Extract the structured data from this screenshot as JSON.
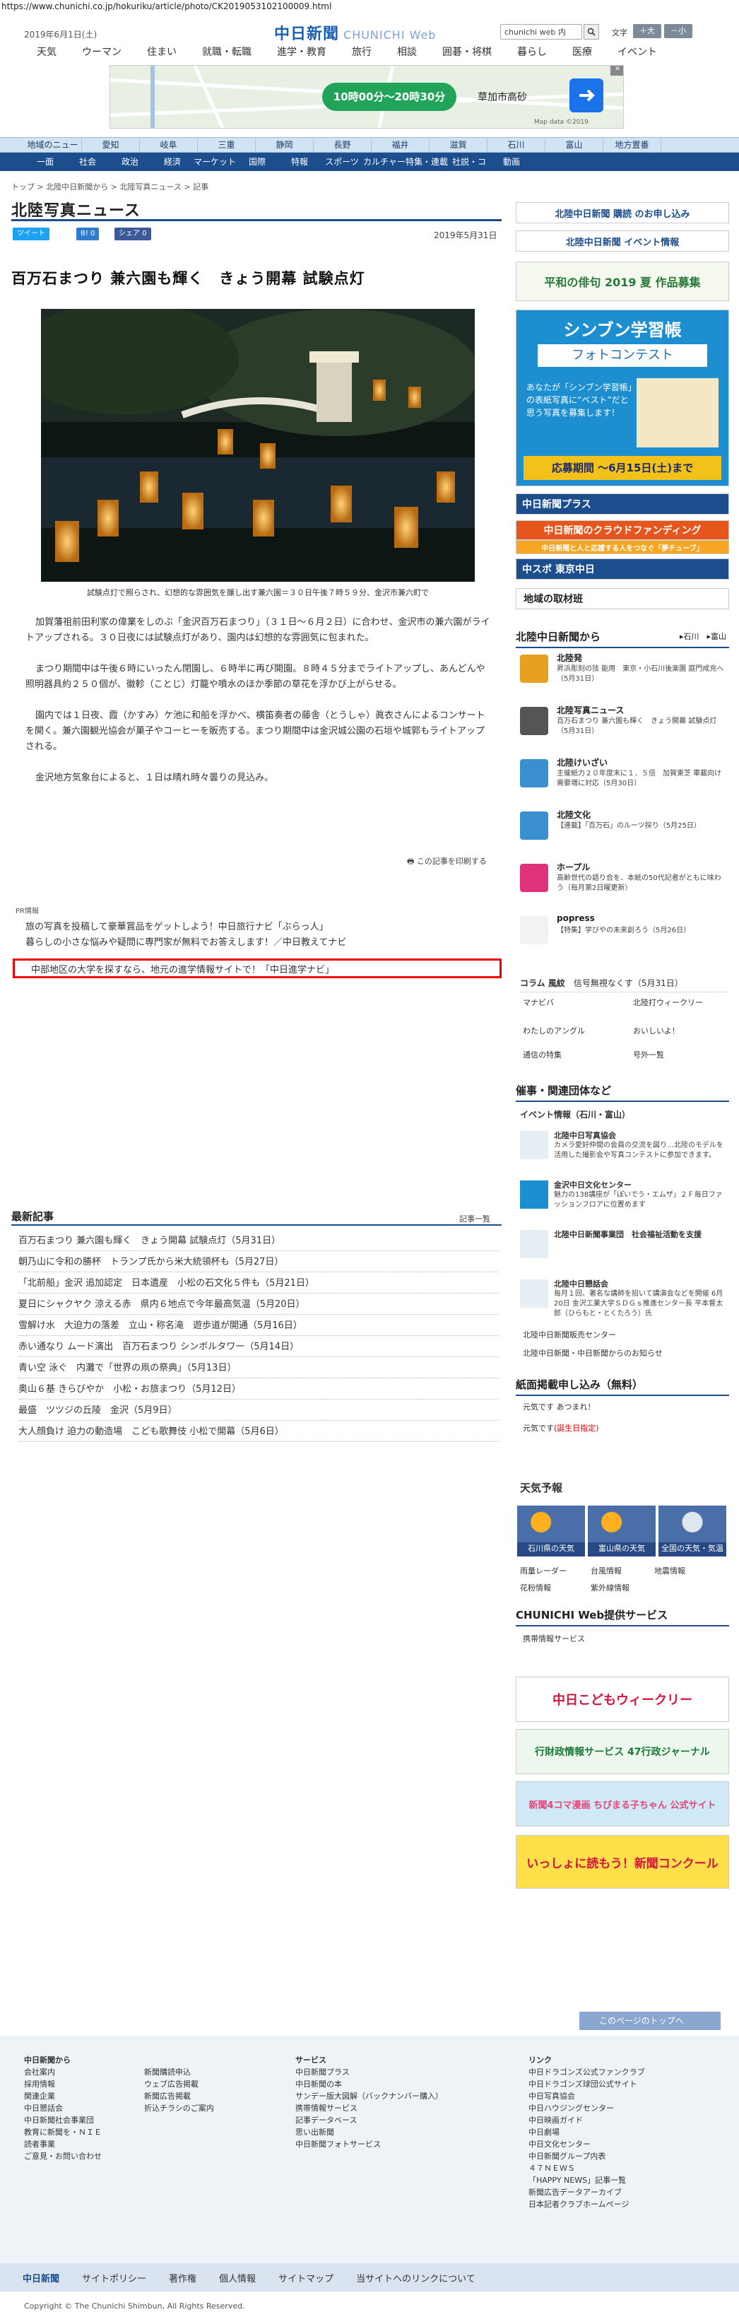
{
  "browser": {
    "url": "https://www.chunichi.co.jp/hokuriku/article/photo/CK2019053102100009.html"
  },
  "header": {
    "date": "2019年6月1日(土)",
    "logo": "中日新聞",
    "logo_sub": "CHUNICHI Web",
    "search_value": "chunichi web 内",
    "font_label": "文字",
    "font_large": "＋大",
    "font_small": "－小",
    "nav": [
      "天気",
      "ウーマン",
      "住まい",
      "就職・転職",
      "進学・教育",
      "旅行",
      "相談",
      "囲碁・将棋",
      "暮らし",
      "医療",
      "イベント"
    ]
  },
  "ad": {
    "time": "10時00分～20時30分",
    "dest": "草加市高砂",
    "copy": "Map data ©2019"
  },
  "nav1": [
    "地域のニュース",
    "愛知",
    "岐阜",
    "三重",
    "静岡",
    "長野",
    "福井",
    "滋賀",
    "石川",
    "富山",
    "地方置番"
  ],
  "nav2": [
    "一面",
    "社会",
    "政治",
    "経済",
    "マーケット",
    "国際",
    "特報",
    "スポーツ",
    "カルチャー",
    "特集・連載",
    "社説・コラム",
    "動画"
  ],
  "breadcrumb": "トップ > 北陸中日新聞から > 北陸写真ニュース > 記事",
  "section_title": "北陸写真ニュース",
  "sns": {
    "tweet": "ツイート",
    "hatena": "B! 0",
    "share": "シェア 0"
  },
  "article": {
    "date": "2019年5月31日",
    "headline": "百万石まつり 兼六園も輝く　きょう開幕 試験点灯",
    "caption": "試験点灯で照らされ、幻想的な雰囲気を醸し出す兼六園＝３０日午後７時５９分、金沢市兼六町で",
    "paragraphs": [
      "加賀藩祖前田利家の偉業をしのぶ「金沢百万石まつり」（３１日～６月２日）に合わせ、金沢市の兼六園がライトアップされる。３０日夜には試験点灯があり、園内は幻想的な雰囲気に包まれた。",
      "まつり期間中は午後６時にいったん閉園し、６時半に再び開園。８時４５分までライトアップし、あんどんや照明器具約２５０個が、徽軫（ことじ）灯籠や噴水のほか季節の草花を浮かび上がらせる。",
      "園内では１日夜、霞（かすみ）ケ池に和船を浮かべ、横笛奏者の藤舎（とうしゃ）眞衣さんによるコンサートを開く。兼六園観光協会が菓子やコーヒーを販売する。まつり期間中は金沢城公園の石垣や城郭もライトアップされる。",
      "金沢地方気象台によると、１日は晴れ時々曇りの見込み。"
    ],
    "print": "この記事を印刷する"
  },
  "pr": {
    "label": "PR情報",
    "items": [
      "旅の写真を投稿して豪華賞品をゲットしよう！中日旅行ナビ「ぶらっ人」",
      "暮らしの小さな悩みや疑問に専門家が無料でお答えします！／中日教えてナビ",
      "中部地区の大学を探すなら、地元の進学情報サイトで！「中日進学ナビ」"
    ]
  },
  "latest": {
    "title": "最新記事",
    "more": "記事一覧",
    "items": [
      "百万石まつり 兼六園も輝く　きょう開幕 試験点灯（5月31日）",
      "朝乃山に令和の勝杯　トランプ氏から米大統領杯も（5月27日）",
      "「北前船」金沢 追加認定　日本遺産　小松の石文化５件も（5月21日）",
      "夏日にシャクヤク 涼える赤　県内６地点で今年最高気温（5月20日）",
      "雪解け水　大迫力の落差　立山・称名滝　遊歩道が開通（5月16日）",
      "赤い通なり ムード演出　百万石まつり シンボルタワー（5月14日）",
      "青い空 泳ぐ　内灘で「世界の凧の祭典」（5月13日）",
      "奥山６基 きらびやか　小松・お旅まつり（5月12日）",
      "最盛　ツツジの丘陵　金沢（5月9日）",
      "大人顔負け 迫力の動造場　こども歌舞伎 小松で開幕（5月6日）"
    ]
  },
  "right": {
    "b1": "北陸中日新聞 購読 のお申し込み",
    "b2": "北陸中日新聞 イベント情報",
    "b3": "平和の俳句 2019 夏 作品募集",
    "b4_title": "シンブン学習帳",
    "b4_sub": "フォトコンテスト",
    "b4_text": "あなたが「シンブン学習帳」の表紙写真に“ベスト”だと思う写真を募集します！",
    "b4_deadline": "応募期間 ～6月15日(土)まで",
    "b5": "中日新聞プラス",
    "b6": "中日新聞のクラウドファンディング",
    "b7": "中日新聞と人と応援する人をつなぐ「夢チューブ」",
    "b8": "中スポ 東京中日",
    "b9": "地域の取材班",
    "from_title": "北陸中日新聞から",
    "from_links": [
      "石川",
      "富山"
    ],
    "news": [
      {
        "t": "北陸発",
        "d": "昇浜彫刻の技 能用　東京・小石川後楽園 庭門成充へ（5月31日）",
        "c": "#e8a020"
      },
      {
        "t": "北陸写真ニュース",
        "d": "百万石まつり 兼六園も輝く　きょう開幕 試験点灯（5月31日）",
        "c": "#555555"
      },
      {
        "t": "北陸けいざい",
        "d": "主催紙力２０年度末に１．５倍　加賀東芝 車載向け需要増に対応（5月30日）",
        "c": "#3a8fd0"
      },
      {
        "t": "北陸文化",
        "d": "【連載】「百万石」のルーツ探り（5月25日）",
        "c": "#3a8fd0"
      },
      {
        "t": "ホープル",
        "d": "高齢世代の語り合を、本紙の50代記者がともに味わう（毎月第2日曜更新）",
        "c": "#e0327a"
      },
      {
        "t": "popress",
        "d": "【特集】学びやの未来創ろう（5月26日）",
        "c": "#f2f2f2"
      }
    ],
    "col": [
      "コラム 風紋",
      "信号無視なくす（5月31日）"
    ],
    "links": [
      "マナビバ",
      "北陸打ウィークリー",
      "わたしのアングル",
      "おいしいよ！",
      "通信の特集",
      "号外一覧"
    ],
    "events_title": "催事・関連団体など",
    "events_head": "イベント情報（石川・富山）",
    "events": [
      {
        "t": "北陸中日写真協会",
        "d": "カメラ愛好仲間の会員の交流を図り…北陸のモデルを活用した撮影会や写真コンテストに参加できます。"
      },
      {
        "t": "金沢中日文化センター",
        "d": "魅力の138講座が「ぽいでう・エムザ」２Ｆ毎日ファッションフロアに位置めます"
      },
      {
        "t": "北陸中日新聞事業団　社会福祉活動を支援",
        "d": ""
      },
      {
        "t": "北陸中日懇話会",
        "d": "毎月１回、著名な講師を招いて講演会などを開催 6月20日 金沢工業大学ＳＤＧｓ推進センター長 平本督太郎（ひらもと・とくたろう）氏"
      }
    ],
    "events_links": [
      "北陸中日新聞販売センター",
      "北陸中日新聞・中日新聞からのお知らせ"
    ],
    "apply_title": "紙面掲載申し込み（無料）",
    "apply": [
      "元気です あつまれ！",
      "元気です"
    ],
    "apply_note": "(誕生日指定)",
    "weather_title": "天気予報",
    "weather": [
      "石川県の天気",
      "富山県の天気",
      "全国の天気・気温"
    ],
    "weather_links": [
      "雨量レーダー",
      "台風情報",
      "地震情報",
      "花粉情報",
      "紫外線情報"
    ],
    "service_title": "CHUNICHI Web提供サービス",
    "service_link": "携帯情報サービス",
    "ad1": "中日こどもウィークリー",
    "ad2": "行財政情報サービス 47行政ジャーナル",
    "ad3": "新聞4コマ漫画 ちびまる子ちゃん 公式サイト",
    "ad4": "いっしょに読もう！新聞コンクール"
  },
  "footer": {
    "to_top": "このページのトップへ",
    "col1_title": "中日新聞から",
    "col1": [
      "会社案内",
      "採用情報",
      "関連企業",
      "中日懇話会",
      "中日新聞社会事業団",
      "教育に新聞を・ＮＩＥ",
      "読者事業",
      "ご意見・お問い合わせ"
    ],
    "col2": [
      "新聞購読申込",
      "ウェブ広告掲載",
      "新聞広告掲載",
      "折込チラシのご案内"
    ],
    "col3_title": "サービス",
    "col3": [
      "中日新聞プラス",
      "中日新聞の本",
      "サンデー版大図解（バックナンバー購入）",
      "携帯情報サービス",
      "記事データベース",
      "思い出新聞",
      "中日新聞フォトサービス"
    ],
    "col4_title": "リンク",
    "col4": [
      "中日ドラゴンズ公式ファンクラブ",
      "中日ドラゴンズ球団公式サイト",
      "中日写真協会",
      "中日ハウジングセンター",
      "中日映画ガイド",
      "中日劇場",
      "中日文化センター",
      "中日新聞グループ内表",
      "４７ＮＥＷＳ",
      "「HAPPY NEWS」記事一覧",
      "新聞広告データアーカイブ",
      "日本記者クラブホームページ"
    ],
    "bar": [
      "中日新聞",
      "サイトポリシー",
      "著作権",
      "個人情報",
      "サイトマップ",
      "当サイトへのリンクについて"
    ],
    "copyright": "Copyright © The Chunichi Shimbun, All Rights Reserved."
  }
}
